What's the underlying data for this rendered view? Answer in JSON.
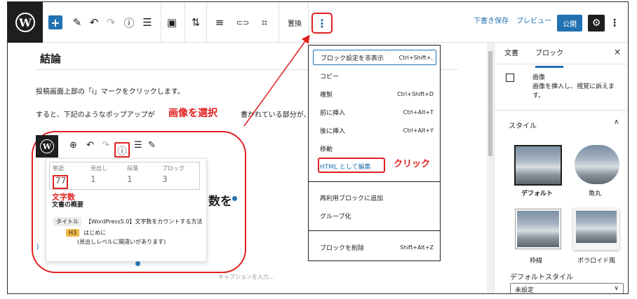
{
  "toolbar": {
    "add": "+",
    "pencil": "✎",
    "undo": "↶",
    "redo": "↷",
    "info": "ⓘ",
    "list": "☰",
    "image": "▣",
    "updown": "⇅",
    "align": "≡",
    "link": "⊂⊃",
    "crop": "⌗",
    "replace": "置換",
    "more": "⋮",
    "save_draft": "下書き保存",
    "preview": "プレビュー",
    "publish": "公開",
    "settings": "⚙",
    "options": "⋮"
  },
  "content": {
    "heading": "結論",
    "para1": "投稿画面上部の「i」マークをクリックします。",
    "para2": "すると、下記のようなポップアップが",
    "para2_tail": "書かれている部分が、",
    "annotation_select": "画像を選択",
    "big_text": "数を",
    "brace": "}",
    "caption": "キャプションを入力..."
  },
  "popover": {
    "stats": [
      {
        "label": "単語",
        "value": "77"
      },
      {
        "label": "見出し",
        "value": "1"
      },
      {
        "label": "段落",
        "value": "1"
      },
      {
        "label": "ブロック",
        "value": "3"
      }
    ],
    "annotation_count": "文字数",
    "outline_title": "文書の概要",
    "title_tag": "タイトル",
    "title_text": "【WordPress5.0】文字数をカウントする方法",
    "h3_tag": "H3",
    "h3_text": "はじめに",
    "h3_note": "(見出しレベルに間違いがあります)"
  },
  "menu": {
    "items": [
      {
        "label": "ブロック設定を非表示",
        "shortcut": "Ctrl+Shift+,"
      },
      {
        "label": "コピー",
        "shortcut": ""
      },
      {
        "label": "複製",
        "shortcut": "Ctrl+Shift+D"
      },
      {
        "label": "前に挿入",
        "shortcut": "Ctrl+Alt+T"
      },
      {
        "label": "後に挿入",
        "shortcut": "Ctrl+Alt+Y"
      },
      {
        "label": "移動",
        "shortcut": ""
      },
      {
        "label": "HTML として編集",
        "shortcut": ""
      },
      {
        "label": "再利用ブロックに追加",
        "shortcut": ""
      },
      {
        "label": "グループ化",
        "shortcut": ""
      },
      {
        "label": "ブロックを削除",
        "shortcut": "Shift+Alt+Z"
      }
    ],
    "annotation_click": "クリック"
  },
  "sidebar": {
    "tab_document": "文書",
    "tab_block": "ブロック",
    "close": "×",
    "block_name": "画像",
    "block_desc": "画像を挿入し、視覚に訴えます。",
    "styles_heading": "スタイル",
    "styles_chevron": "∧",
    "styles": [
      "デフォルト",
      "角丸",
      "枠線",
      "ポラロイド風"
    ],
    "default_style_label": "デフォルトスタイル",
    "default_style_value": "未設定",
    "default_style_chevron": "∨"
  },
  "colors": {
    "accent": "#2271b1",
    "annotation": "#e02020",
    "dark": "#1e1e1e"
  }
}
